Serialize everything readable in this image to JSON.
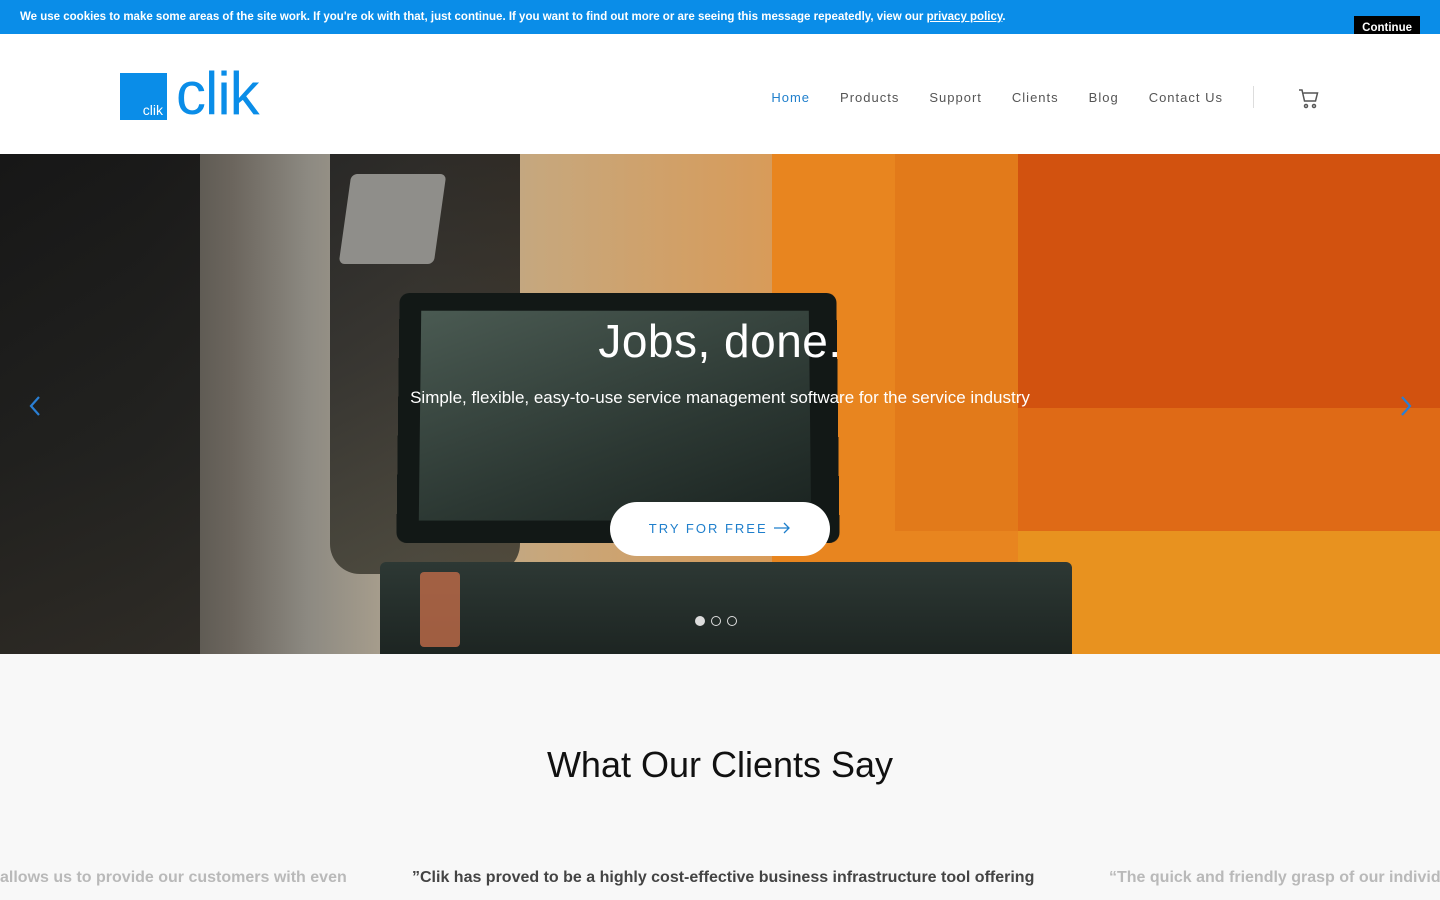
{
  "cookie": {
    "text": "We use cookies to make some areas of the site work. If you're ok with that, just continue. If you want to find out more or are seeing this message repeatedly, view our ",
    "link": "privacy policy",
    "suffix": ".",
    "button": "Continue"
  },
  "brand": {
    "badge": "clik",
    "wordmark": "clik",
    "color": "#0a8de8"
  },
  "nav": {
    "items": [
      "Home",
      "Products",
      "Support",
      "Clients",
      "Blog",
      "Contact Us"
    ],
    "active": "Home",
    "cart_icon": "cart-icon"
  },
  "hero": {
    "title": "Jobs, done.",
    "subtitle": "Simple, flexible, easy-to-use service management software for the service industry",
    "cta": "TRY FOR FREE",
    "cta_icon": "arrow-right-icon",
    "slides": 3,
    "active_slide": 1,
    "prev_icon": "chevron-left-icon",
    "next_icon": "chevron-right-icon"
  },
  "testimonials": {
    "title": "What Our Clients Say",
    "quotes": [
      "allows us to provide our customers with even",
      "”Clik has proved to be a highly cost-effective business infrastructure tool offering",
      "“The quick and friendly grasp of our individ"
    ]
  }
}
